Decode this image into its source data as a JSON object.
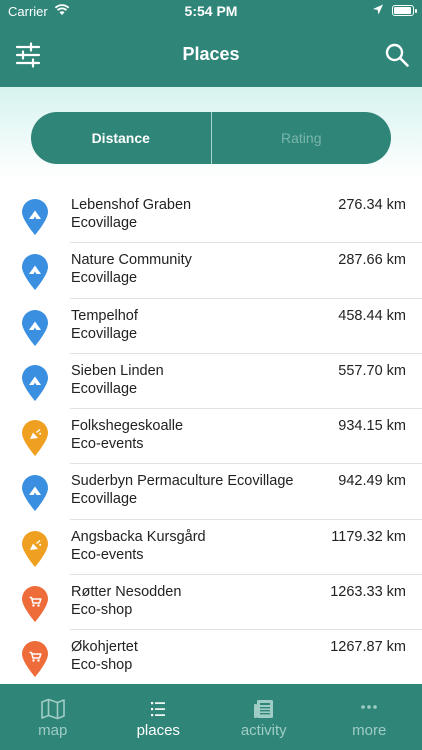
{
  "status_bar": {
    "carrier": "Carrier",
    "time": "5:54 PM"
  },
  "nav": {
    "title": "Places",
    "filter_icon": "sliders-icon",
    "search_icon": "search-icon"
  },
  "sort": {
    "options": [
      "Distance",
      "Rating"
    ],
    "selected": "Distance"
  },
  "places": [
    {
      "name": "Lebenshof Graben",
      "category": "Ecovillage",
      "distance": "276.34 km",
      "icon": "ecovillage-pin-icon"
    },
    {
      "name": "Nature Community",
      "category": "Ecovillage",
      "distance": "287.66 km",
      "icon": "ecovillage-pin-icon"
    },
    {
      "name": "Tempelhof",
      "category": "Ecovillage",
      "distance": "458.44 km",
      "icon": "ecovillage-pin-icon"
    },
    {
      "name": "Sieben Linden",
      "category": "Ecovillage",
      "distance": "557.70 km",
      "icon": "ecovillage-pin-icon"
    },
    {
      "name": "Folkshegeskoalle",
      "category": "Eco-events",
      "distance": "934.15 km",
      "icon": "eco-events-pin-icon"
    },
    {
      "name": "Suderbyn Permaculture Ecovillage",
      "category": "Ecovillage",
      "distance": "942.49 km",
      "icon": "ecovillage-pin-icon"
    },
    {
      "name": "Angsbacka Kursgård",
      "category": "Eco-events",
      "distance": "1179.32 km",
      "icon": "eco-events-pin-icon"
    },
    {
      "name": "Røtter Nesodden",
      "category": "Eco-shop",
      "distance": "1263.33 km",
      "icon": "eco-shop-pin-icon"
    },
    {
      "name": "Økohjertet",
      "category": "Eco-shop",
      "distance": "1267.87 km",
      "icon": "eco-shop-pin-icon"
    }
  ],
  "colors": {
    "primary": "#2f8578",
    "ecovillage": "#3a8fe0",
    "eco_events": "#f0a020",
    "eco_shop": "#ee6b3a"
  },
  "tabs": [
    {
      "label": "map",
      "icon": "map-icon"
    },
    {
      "label": "places",
      "icon": "list-icon",
      "active": true
    },
    {
      "label": "activity",
      "icon": "newspaper-icon"
    },
    {
      "label": "more",
      "icon": "more-icon"
    }
  ]
}
